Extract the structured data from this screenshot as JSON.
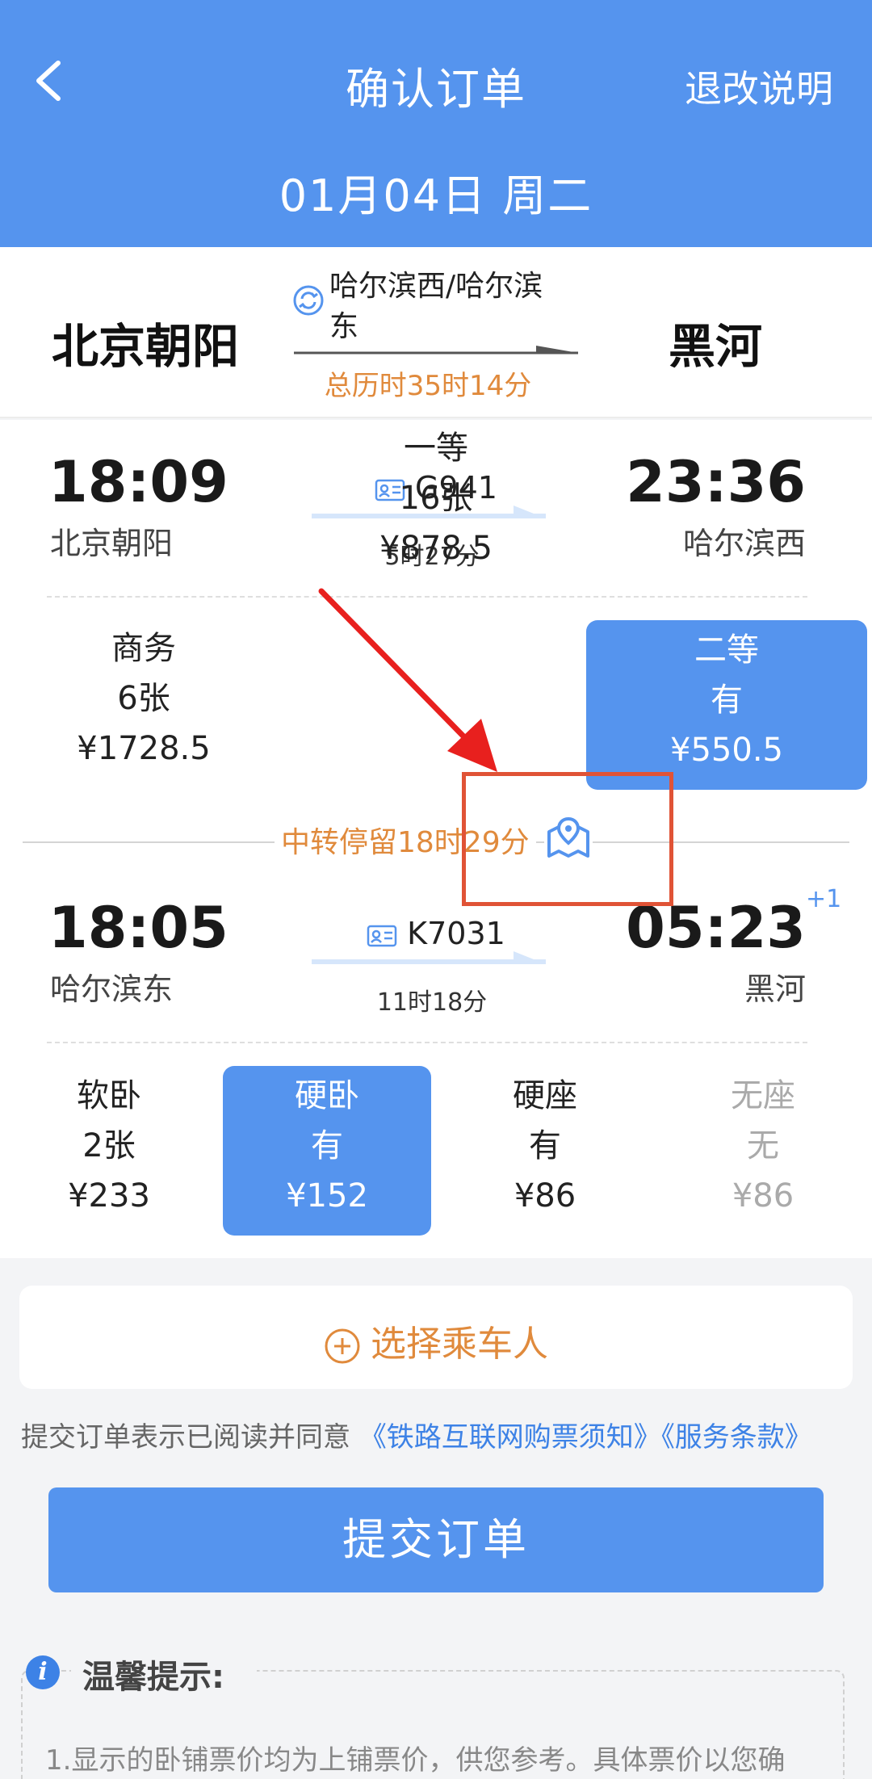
{
  "header": {
    "title": "确认订单",
    "rules_link": "退改说明",
    "date": "01月04日 周二"
  },
  "route": {
    "from": "北京朝阳",
    "to": "黑河",
    "transfer_station": "哈尔滨西/哈尔滨东",
    "total_duration": "总历时35时14分"
  },
  "legs": [
    {
      "depart_time": "18:09",
      "depart_station": "北京朝阳",
      "train_no": "G941",
      "duration": "5时27分",
      "arrive_time": "23:36",
      "arrive_station": "哈尔滨西",
      "day_offset": "",
      "seats": [
        {
          "name": "商务",
          "availability": "6张",
          "price": "¥1728.5",
          "state": "normal"
        },
        {
          "name": "一等",
          "availability": "16张",
          "price": "¥878.5",
          "state": "normal"
        },
        {
          "name": "二等",
          "availability": "有",
          "price": "¥550.5",
          "state": "selected"
        }
      ]
    },
    {
      "depart_time": "18:05",
      "depart_station": "哈尔滨东",
      "train_no": "K7031",
      "duration": "11时18分",
      "arrive_time": "05:23",
      "arrive_station": "黑河",
      "day_offset": "+1",
      "seats": [
        {
          "name": "软卧",
          "availability": "2张",
          "price": "¥233",
          "state": "normal"
        },
        {
          "name": "硬卧",
          "availability": "有",
          "price": "¥152",
          "state": "selected"
        },
        {
          "name": "硬座",
          "availability": "有",
          "price": "¥86",
          "state": "normal"
        },
        {
          "name": "无座",
          "availability": "无",
          "price": "¥86",
          "state": "disabled"
        }
      ]
    }
  ],
  "transfer": {
    "text": "中转停留18时29分"
  },
  "passenger": {
    "label": "选择乘车人"
  },
  "agreement": {
    "prefix": "提交订单表示已阅读并同意",
    "link1": "《铁路互联网购票须知》",
    "link2": "《服务条款》"
  },
  "submit": {
    "label": "提交订单"
  },
  "tips": {
    "title": "温馨提示:",
    "line1": "1.显示的卧铺票价均为上铺票价，供您参考。具体票价以您确"
  },
  "colors": {
    "primary": "#5594ee",
    "accent_orange": "#e08a3c",
    "annotation_red": "#e05336"
  }
}
